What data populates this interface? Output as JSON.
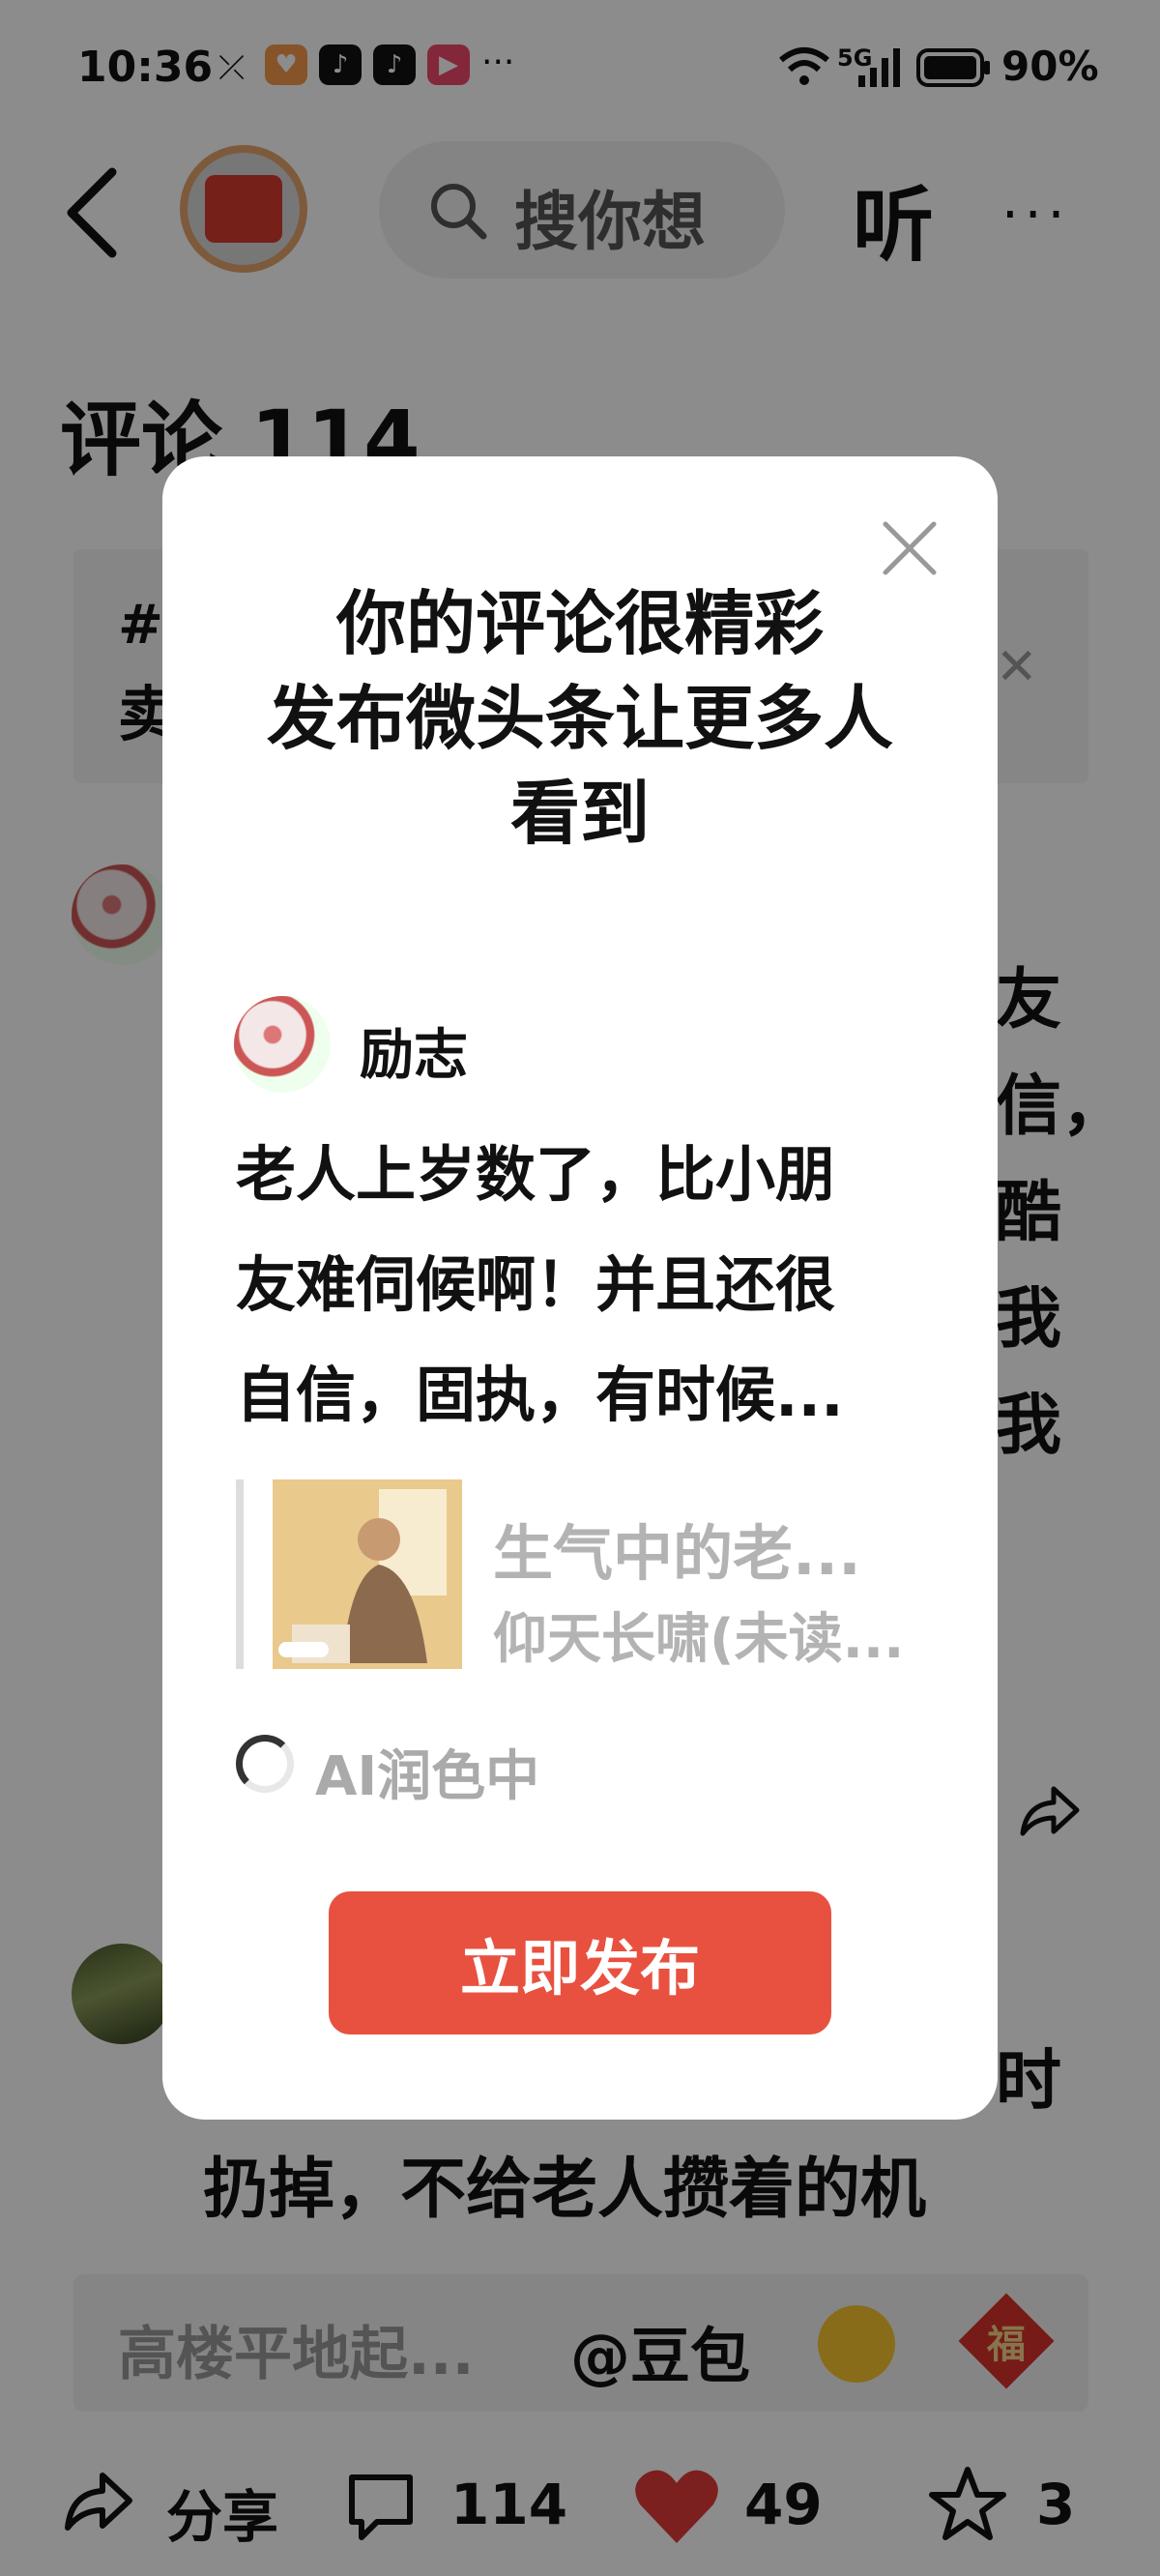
{
  "status_bar": {
    "time": "10:36",
    "network": "5G",
    "battery": "90%"
  },
  "header": {
    "search_placeholder": "搜你想",
    "listen_label": "听",
    "more_label": "···"
  },
  "background": {
    "comment_title": "评论 114",
    "topic_fragment_1": "#",
    "topic_fragment_2": "卖",
    "comment_right_lines": [
      "友",
      "信，",
      "酷",
      "我",
      "我"
    ],
    "comment2_line1": "时",
    "comment2_line2": "扔掉，不给老人攒着的机",
    "input_placeholder": "高楼平地起...",
    "doubao_label": "@豆包",
    "fu_label": "福"
  },
  "bottom_bar": {
    "share_label": "分享",
    "comment_count": "114",
    "like_count": "49",
    "fav_count": "3"
  },
  "dialog": {
    "title_lines": [
      "你的评论很精彩",
      "发布微头条让更多人",
      "看到"
    ],
    "user_name": "励志",
    "comment_lines": [
      "老人上岁数了，比小朋",
      "友难伺候啊！并且还很",
      "自信，固执，有时候..."
    ],
    "quote_title": "生气中的老...",
    "quote_author": "仰天长啸(未读...",
    "ai_status": "AI润色中",
    "publish_label": "立即发布"
  },
  "colors": {
    "publish_button": "#e8513f",
    "like_heart": "#e23a3a",
    "overlay": "rgba(0,0,0,0.45)"
  }
}
